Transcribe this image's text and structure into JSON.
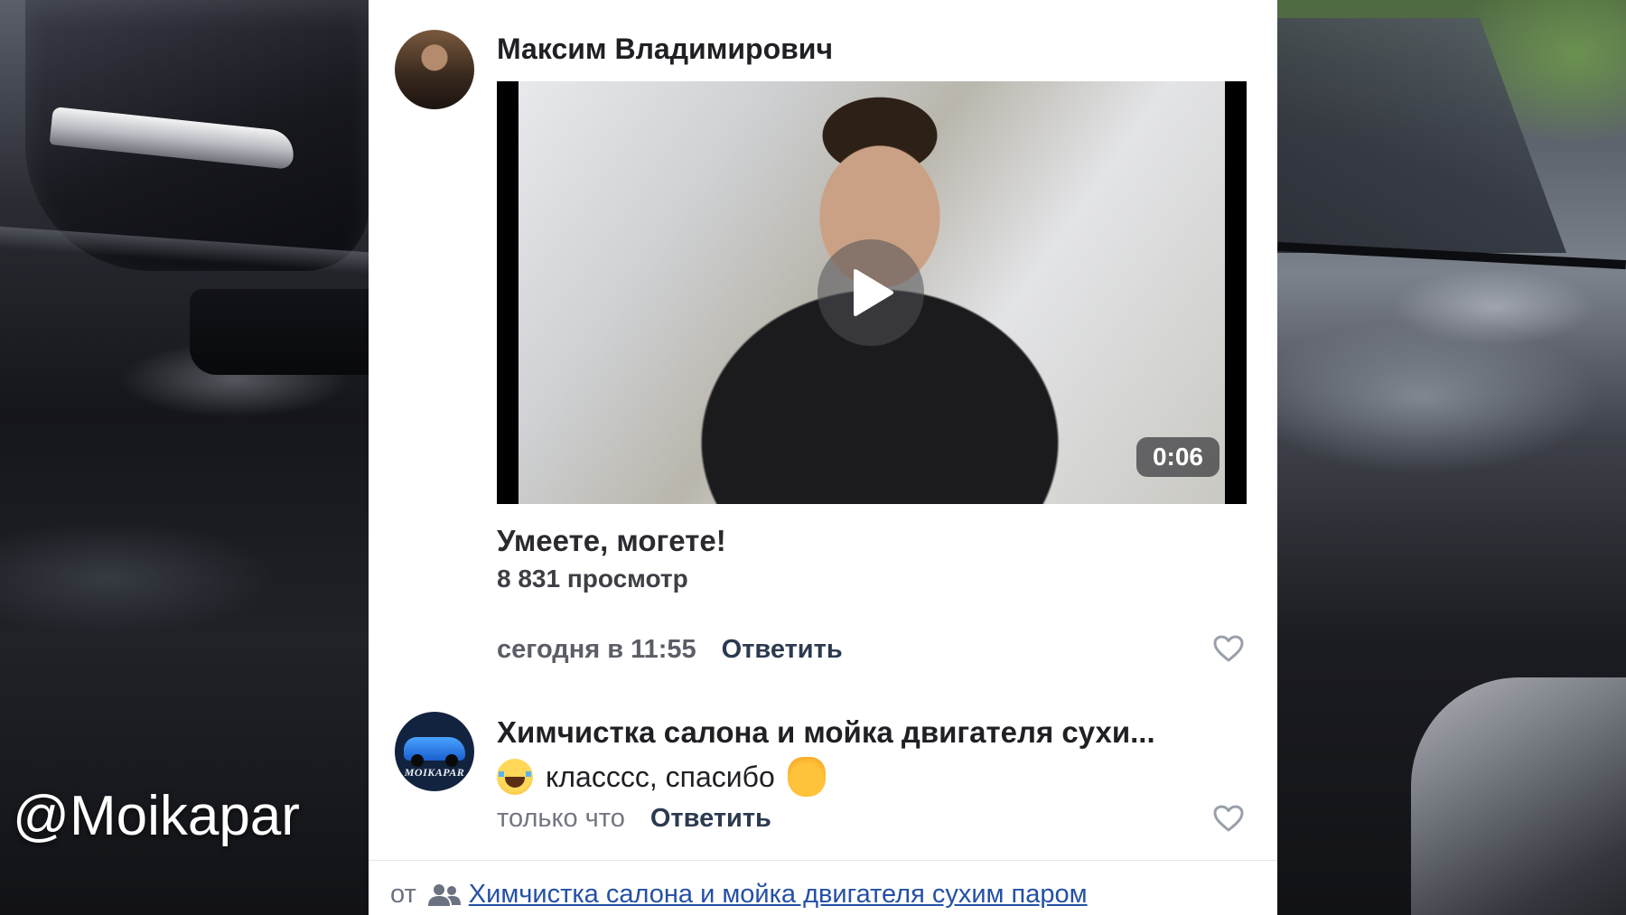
{
  "watermark": "@Moikapar",
  "comment1": {
    "author": "Максим Владимирович",
    "video": {
      "duration": "0:06",
      "title": "Умеете, могете!",
      "views": "8 831 просмотр"
    },
    "time": "сегодня в 11:55",
    "reply_label": "Ответить"
  },
  "comment2": {
    "author": "Химчистка салона и мойка двигателя сухи...",
    "avatar_text": "MOIKAPAR",
    "text": "класссс, спасибо",
    "time": "только что",
    "reply_label": "Ответить"
  },
  "source": {
    "prefix": "от",
    "link": "Химчистка салона и мойка двигателя сухим паром"
  },
  "colors": {
    "link": "#2450a6",
    "reply": "#2b3a4f",
    "panel": "#ffffff"
  },
  "icons": [
    "play-icon",
    "heart-icon",
    "group-icon",
    "laugh-cry-emoji",
    "raised-hand-emoji"
  ]
}
